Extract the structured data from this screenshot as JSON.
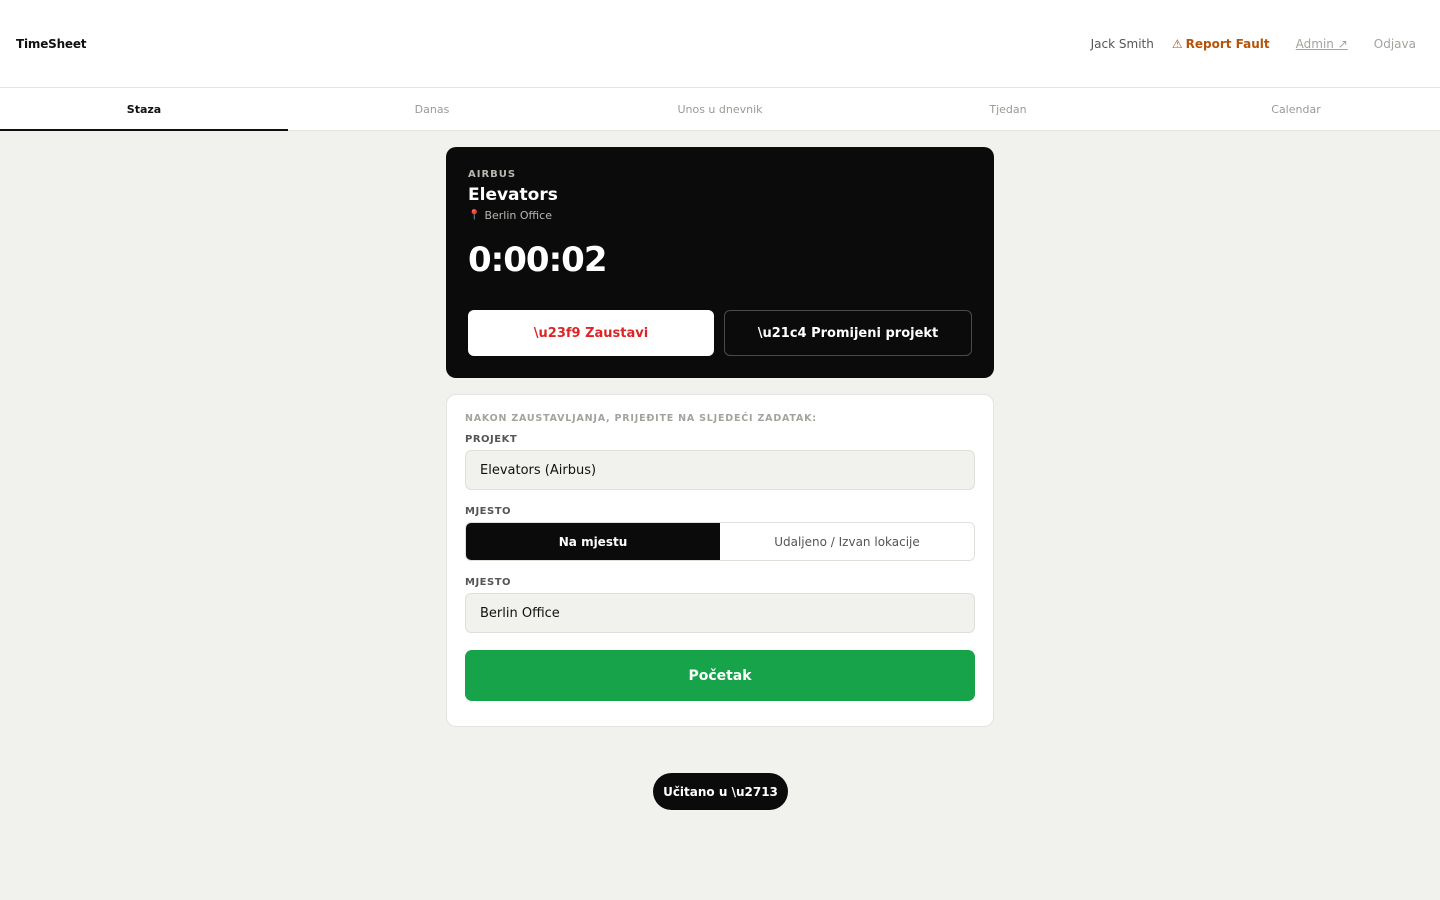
{
  "header": {
    "brand": "TimeSheet",
    "user_name": "Jack Smith",
    "report_fault_icon": "⚠",
    "report_fault_label": "Report Fault",
    "admin_label": "Admin ↗",
    "logout_label": "Odjava"
  },
  "tabs": [
    {
      "label": "Staza",
      "active": true
    },
    {
      "label": "Danas",
      "active": false
    },
    {
      "label": "Unos u dnevnik",
      "active": false
    },
    {
      "label": "Tjedan",
      "active": false
    },
    {
      "label": "Calendar",
      "active": false
    }
  ],
  "timer": {
    "client": "AIRBUS",
    "project": "Elevators",
    "pin_icon": "📍",
    "location": "Berlin Office",
    "elapsed": "0:00:02",
    "stop_label": "\\u23f9 Zaustavi",
    "switch_label": "\\u21c4 Promijeni projekt"
  },
  "next_task": {
    "note": "NAKON ZAUSTAVLJANJA, PRIJEĐITE NA SLJEDEĆI ZADATAK:",
    "project_label": "PROJEKT",
    "project_value": "Elevators (Airbus)",
    "mode_label": "MJESTO",
    "mode_options": [
      {
        "label": "Na mjestu",
        "active": true
      },
      {
        "label": "Udaljeno / Izvan lokacije",
        "active": false
      }
    ],
    "location_label": "MJESTO",
    "location_value": "Berlin Office",
    "start_label": "Početak"
  },
  "toast": {
    "label": "Učitano u \\u2713"
  },
  "colors": {
    "accent_green": "#16a34a",
    "stop_red": "#dc2626",
    "fault_orange": "#b45309",
    "dark": "#0b0b0b"
  }
}
